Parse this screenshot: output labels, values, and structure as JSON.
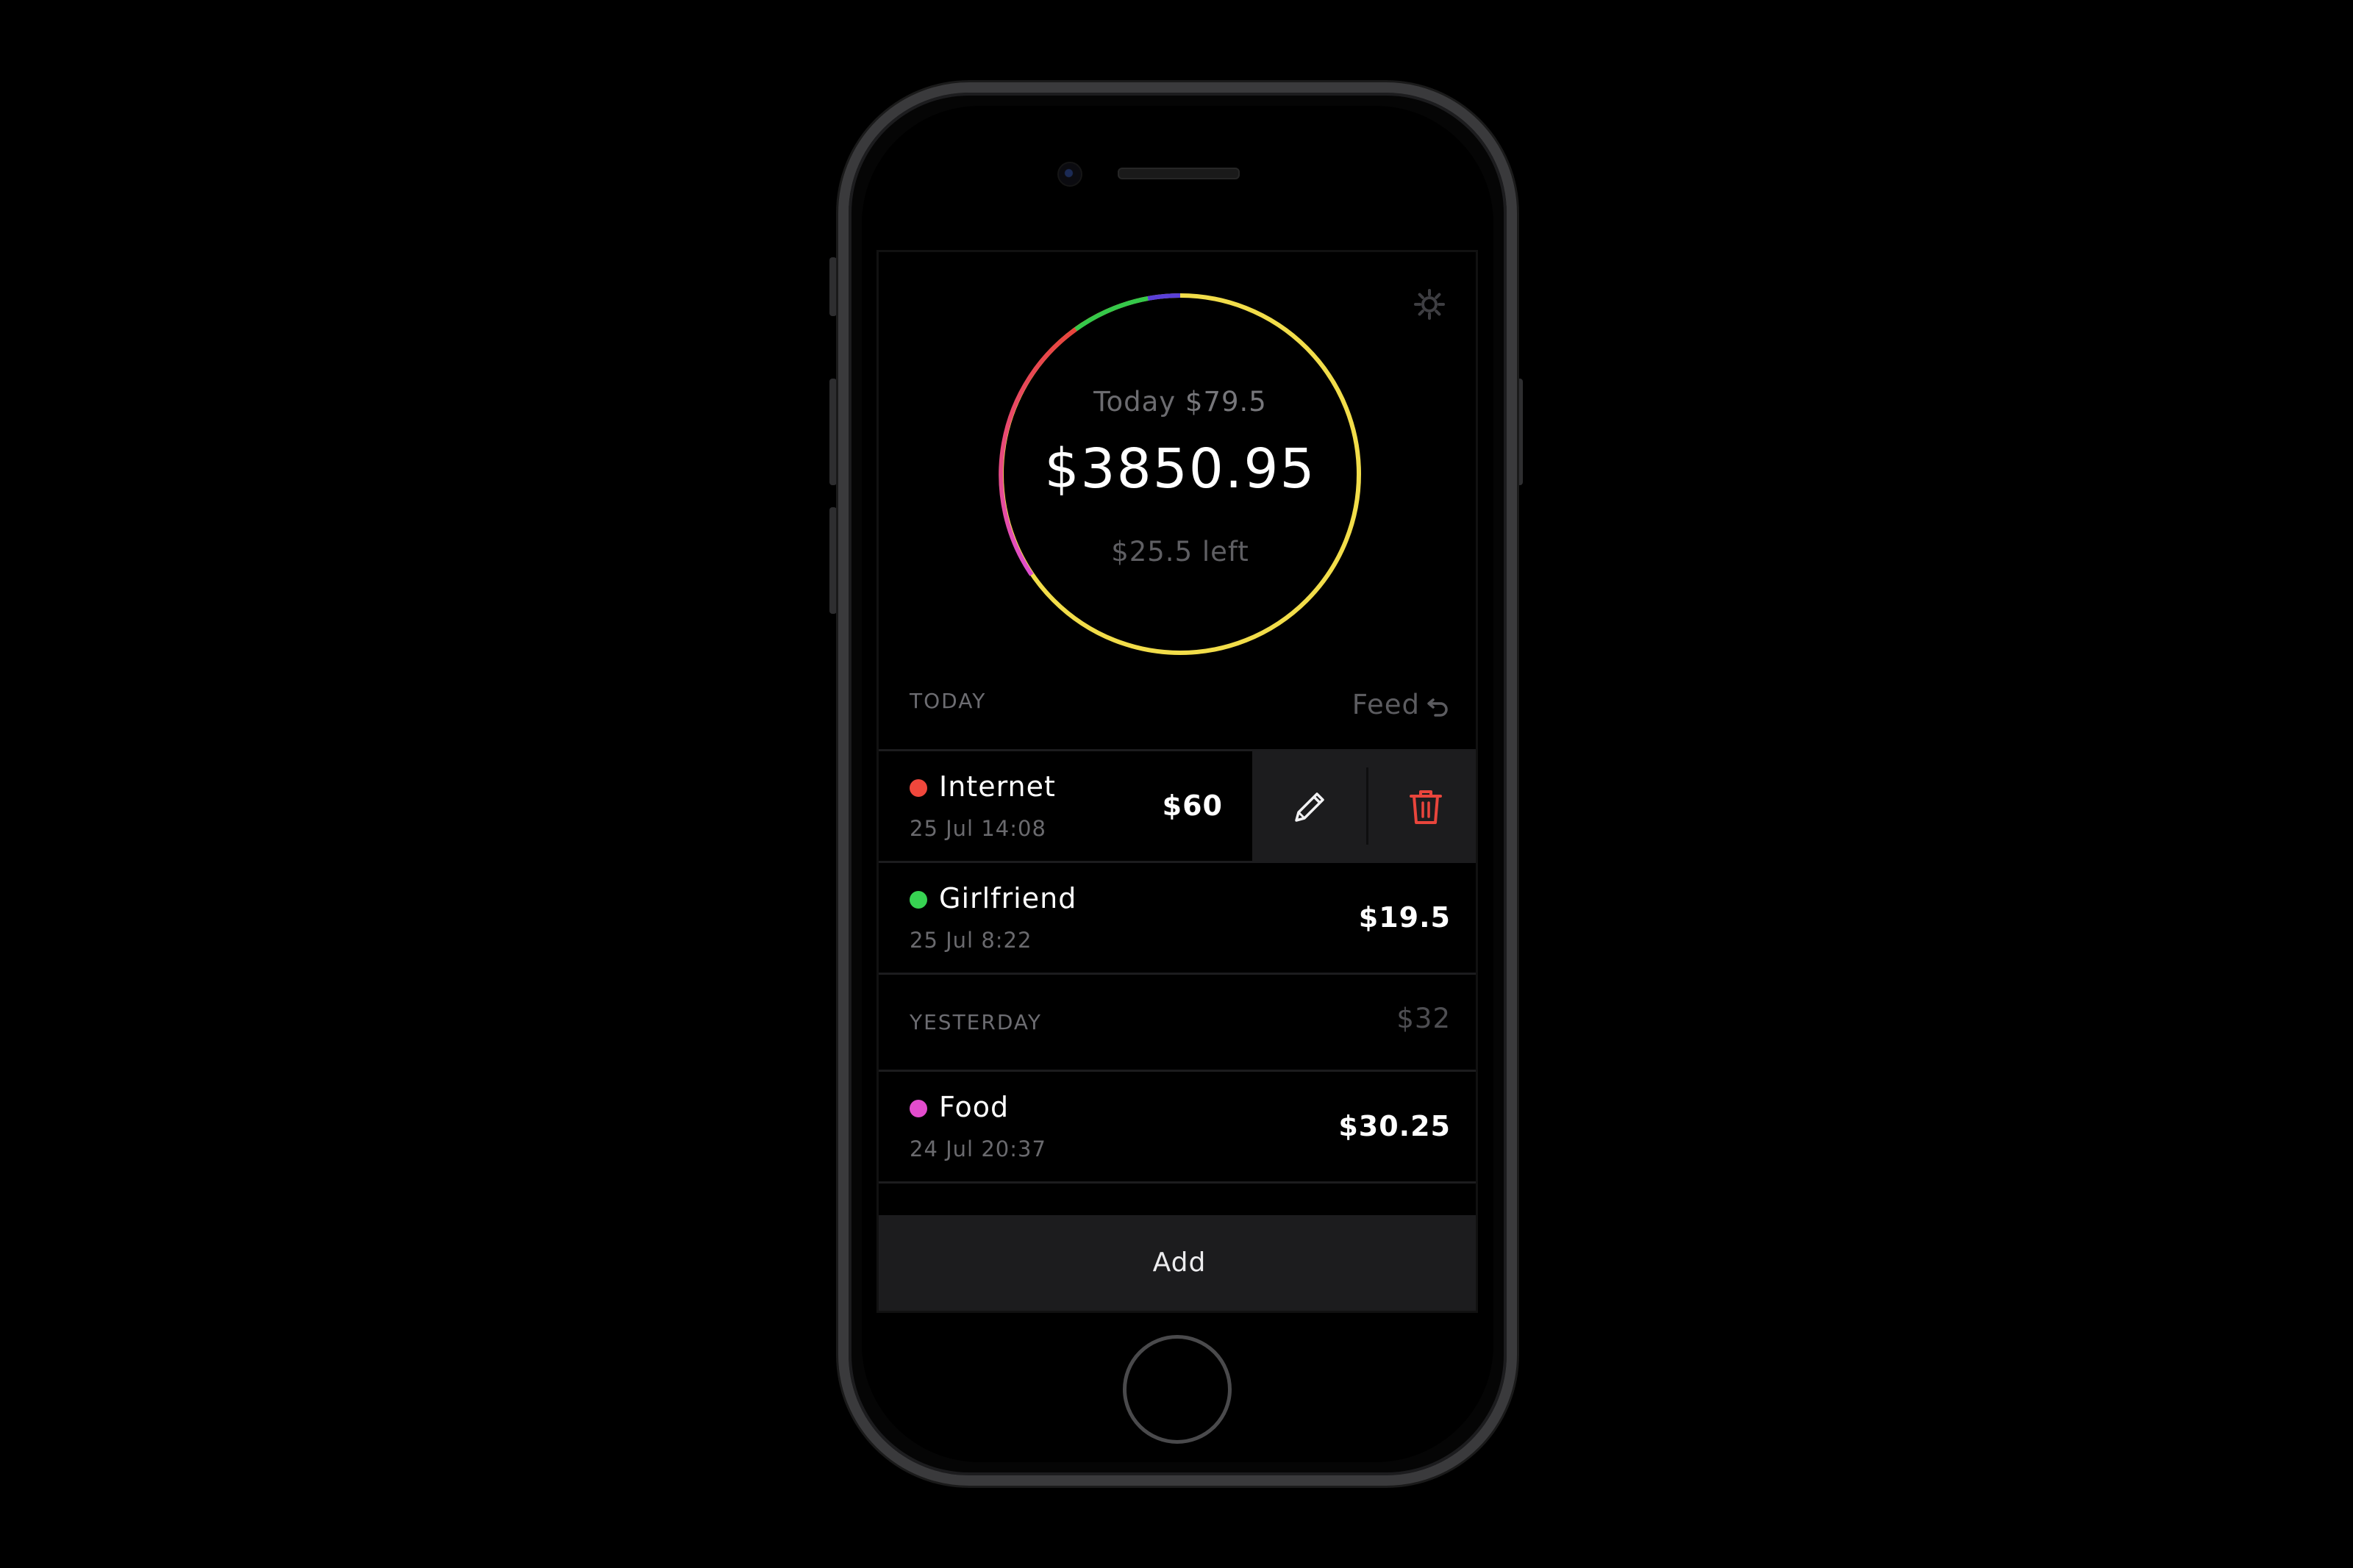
{
  "summary": {
    "today_label": "Today",
    "today_value": "$79.5",
    "total": "$3850.95",
    "left": "$25.5 left"
  },
  "ring": {
    "segments": [
      {
        "category": "Internet",
        "color": "#e8453c"
      },
      {
        "category": "Girlfriend",
        "color": "#35c84a"
      },
      {
        "category": "Food",
        "color": "#e04fc9"
      }
    ],
    "accent_colors": {
      "track": "#f2dd4a",
      "violet": "#5a3fd8"
    }
  },
  "icons": {
    "settings": "gear-icon",
    "feed": "undo-arrow-icon",
    "edit": "pencil-icon",
    "delete": "trash-icon"
  },
  "today": {
    "label": "TODAY",
    "feed_label": "Feed"
  },
  "yesterday": {
    "label": "YESTERDAY",
    "total": "$32"
  },
  "transactions": [
    {
      "name": "Internet",
      "date": "25 Jul 14:08",
      "amount": "$60",
      "color": "#f0473c"
    },
    {
      "name": "Girlfriend",
      "date": "25 Jul 8:22",
      "amount": "$19.5",
      "color": "#37d352"
    },
    {
      "name": "Food",
      "date": "24 Jul 20:37",
      "amount": "$30.25",
      "color": "#e34ccd"
    }
  ],
  "add_button": {
    "label": "Add"
  },
  "colors": {
    "background": "#000000",
    "action_panel": "#1c1c1e",
    "delete": "#e8453c"
  }
}
